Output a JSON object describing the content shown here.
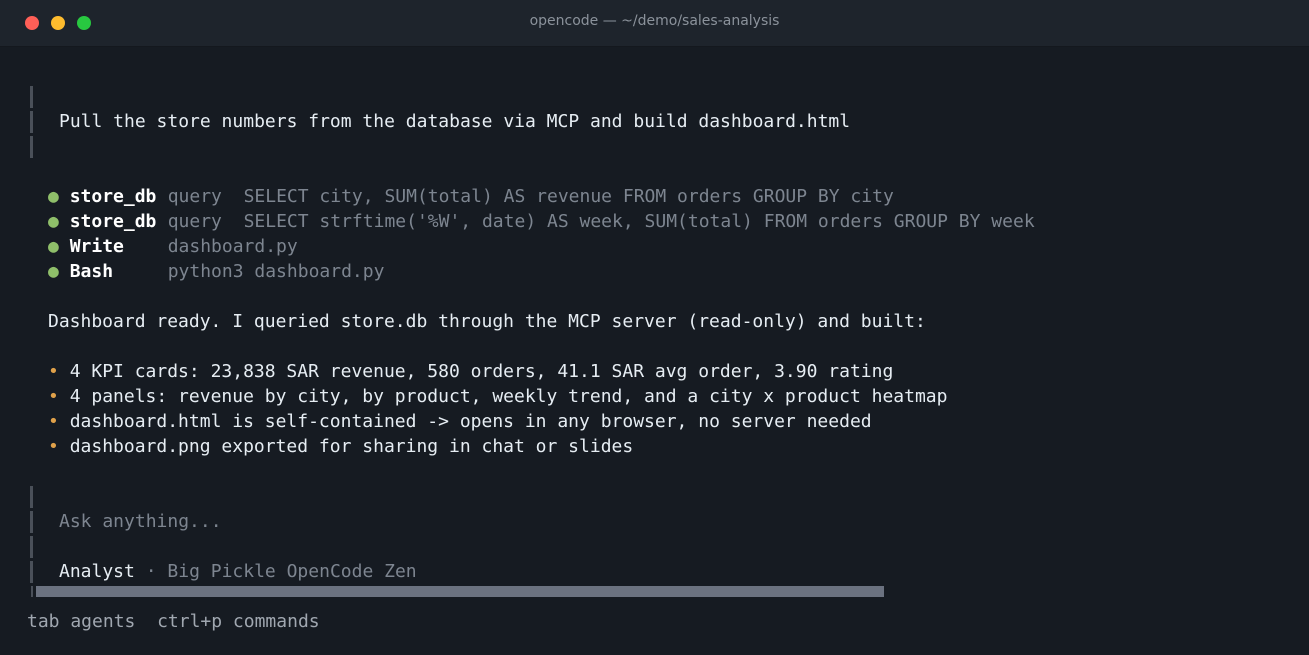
{
  "window": {
    "title": "opencode — ~/demo/sales-analysis"
  },
  "prompt": {
    "text": "Pull the store numbers from the database via MCP and build dashboard.html"
  },
  "tool_calls": [
    {
      "name": "store_db",
      "kind": "query",
      "detail": "SELECT city, SUM(total) AS revenue FROM orders GROUP BY city"
    },
    {
      "name": "store_db",
      "kind": "query",
      "detail": "SELECT strftime('%W', date) AS week, SUM(total) FROM orders GROUP BY week"
    },
    {
      "name": "Write",
      "kind": "",
      "detail": "dashboard.py"
    },
    {
      "name": "Bash",
      "kind": "",
      "detail": "python3 dashboard.py"
    }
  ],
  "response": {
    "summary": "Dashboard ready. I queried store.db through the MCP server (read-only) and built:",
    "bullets": [
      "4 KPI cards: 23,838 SAR revenue, 580 orders, 41.1 SAR avg order, 3.90 rating",
      "4 panels: revenue by city, by product, weekly trend, and a city x product heatmap",
      "dashboard.html is self-contained -> opens in any browser, no server needed",
      "dashboard.png exported for sharing in chat or slides"
    ]
  },
  "input": {
    "placeholder": "Ask anything...",
    "agent": "Analyst",
    "separator": "·",
    "model": "Big Pickle OpenCode Zen"
  },
  "footer": {
    "hint1": "tab agents",
    "hint2": "ctrl+p commands"
  },
  "colors": {
    "background": "#161b22",
    "tool_dot": "#8fbf6a",
    "bullet_dot": "#e0a14a",
    "close": "#ff5f57",
    "minimize": "#febc2e",
    "maximize": "#28c840"
  },
  "icons": {
    "tool_status": "●",
    "bullet": "•"
  }
}
